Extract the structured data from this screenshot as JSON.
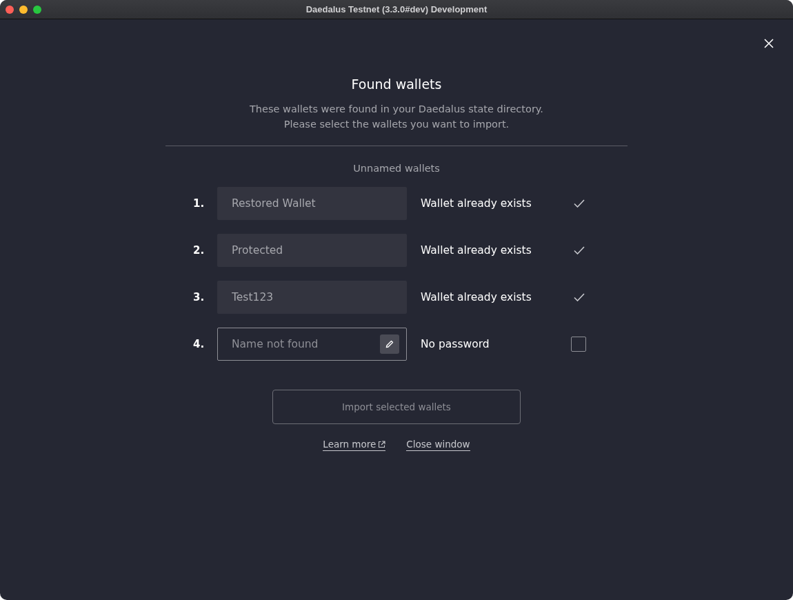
{
  "window": {
    "title": "Daedalus Testnet (3.3.0#dev) Development"
  },
  "dialog": {
    "title": "Found wallets",
    "description": [
      "These wallets were found in your Daedalus state directory.",
      "Please select the wallets you want to import."
    ],
    "section": "Unnamed wallets",
    "wallets": [
      {
        "number": "1.",
        "kind": "exists",
        "value": "Restored Wallet",
        "status": "Wallet already exists"
      },
      {
        "number": "2.",
        "kind": "exists",
        "value": "Protected",
        "status": "Wallet already exists"
      },
      {
        "number": "3.",
        "kind": "exists",
        "value": "Test123",
        "status": "Wallet already exists"
      },
      {
        "number": "4.",
        "kind": "new",
        "placeholder": "Name not found",
        "status": "No password",
        "checked": false
      }
    ],
    "import_button": {
      "label": "Import selected wallets",
      "disabled": true
    },
    "links": [
      "Learn more",
      "Close window"
    ]
  }
}
